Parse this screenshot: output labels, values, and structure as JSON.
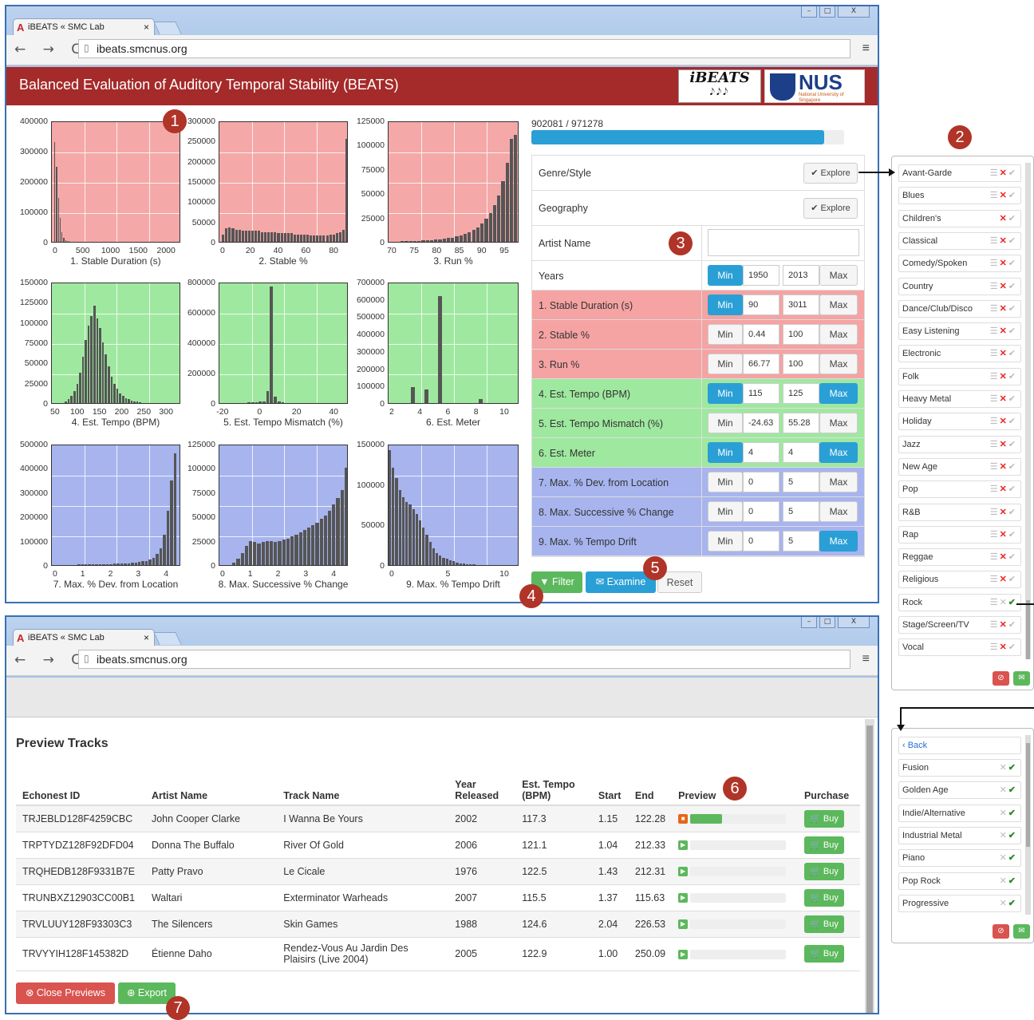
{
  "browser": {
    "tab_title": "iBEATS « SMC Lab",
    "tab_close": "×",
    "url": "ibeats.smcnus.org",
    "nav": "← → C",
    "menu": "≡",
    "win_controls": [
      "–",
      "□",
      "X"
    ]
  },
  "header": {
    "title": "Balanced Evaluation of Auditory Temporal Stability (BEATS)",
    "logo1_top": "iBEATS",
    "logo1_bottom": "𝅘𝅥𝅮𝅘𝅥𝅮𝅘𝅥𝅮",
    "logo2_name": "NUS",
    "logo2_sub": "National University of Singapore"
  },
  "markers": [
    "1",
    "2",
    "3",
    "4",
    "5",
    "6",
    "7"
  ],
  "charts": [
    {
      "caption": "1. Stable Duration (s)",
      "color": "#f5a8a8",
      "yticks": [
        "400000",
        "300000",
        "200000",
        "100000",
        "0"
      ],
      "xticks": [
        "0",
        "500",
        "1000",
        "1500",
        "2000"
      ],
      "bars": [
        0.82,
        0.62,
        0.36,
        0.2,
        0.08,
        0.03,
        0.015,
        0.008,
        0.005,
        0.003,
        0.002,
        0.002,
        0.001,
        0.001,
        0.001,
        0.001,
        0.001,
        0.001,
        0,
        0,
        0,
        0,
        0,
        0,
        0,
        0,
        0,
        0,
        0,
        0,
        0,
        0,
        0,
        0,
        0,
        0
      ],
      "bar_start": 0.02,
      "bar_end": 0.52
    },
    {
      "caption": "2. Stable %",
      "color": "#f5a8a8",
      "yticks": [
        "300000",
        "250000",
        "200000",
        "150000",
        "100000",
        "50000",
        "0"
      ],
      "xticks": [
        "0",
        "20",
        "40",
        "60",
        "80"
      ],
      "bars": [
        0.06,
        0.11,
        0.12,
        0.11,
        0.1,
        0.1,
        0.09,
        0.09,
        0.09,
        0.09,
        0.09,
        0.09,
        0.08,
        0.08,
        0.08,
        0.08,
        0.08,
        0.07,
        0.07,
        0.07,
        0.07,
        0.07,
        0.06,
        0.06,
        0.06,
        0.06,
        0.06,
        0.05,
        0.05,
        0.05,
        0.05,
        0.05,
        0.05,
        0.06,
        0.06,
        0.07,
        0.08,
        0.1,
        0.85
      ],
      "bar_start": 0.02,
      "bar_end": 1.0
    },
    {
      "caption": "3. Run %",
      "color": "#f5a8a8",
      "yticks": [
        "125000",
        "100000",
        "75000",
        "50000",
        "25000",
        "0"
      ],
      "xticks": [
        "70",
        "75",
        "80",
        "85",
        "90",
        "95"
      ],
      "bars": [
        0.003,
        0.004,
        0.005,
        0.006,
        0.007,
        0.008,
        0.01,
        0.012,
        0.014,
        0.017,
        0.02,
        0.024,
        0.03,
        0.036,
        0.044,
        0.054,
        0.066,
        0.08,
        0.1,
        0.12,
        0.15,
        0.19,
        0.24,
        0.3,
        0.38,
        0.5,
        0.65,
        0.85,
        0.88
      ],
      "bar_start": 0.06,
      "bar_end": 0.99
    },
    {
      "caption": "4. Est. Tempo (BPM)",
      "color": "#9fe89f",
      "yticks": [
        "150000",
        "125000",
        "100000",
        "75000",
        "50000",
        "25000",
        "0"
      ],
      "xticks": [
        "50",
        "100",
        "150",
        "200",
        "250",
        "300"
      ],
      "bars": [
        0.01,
        0.03,
        0.06,
        0.1,
        0.16,
        0.25,
        0.38,
        0.52,
        0.64,
        0.72,
        0.8,
        0.7,
        0.62,
        0.5,
        0.4,
        0.3,
        0.22,
        0.16,
        0.12,
        0.08,
        0.06,
        0.04,
        0.03,
        0.02,
        0.01,
        0.01,
        0.005,
        0.003
      ],
      "bar_start": 0.1,
      "bar_end": 0.72
    },
    {
      "caption": "5. Est. Tempo Mismatch (%)",
      "color": "#9fe89f",
      "yticks": [
        "800000",
        "600000",
        "400000",
        "200000",
        "0"
      ],
      "xticks": [
        "-20",
        "0",
        "20",
        "40"
      ],
      "bars": [
        0.002,
        0.002,
        0.003,
        0.003,
        0.004,
        0.006,
        0.008,
        0.012,
        0.015,
        0.1,
        0.96,
        0.05,
        0.01,
        0.005,
        0.003,
        0.002,
        0.001,
        0.001,
        0.001,
        0.001,
        0.001,
        0.001,
        0.001,
        0.001
      ],
      "bar_start": 0.1,
      "bar_end": 0.8
    },
    {
      "caption": "6. Est. Meter",
      "color": "#9fe89f",
      "yticks": [
        "700000",
        "600000",
        "500000",
        "400000",
        "300000",
        "200000",
        "100000",
        "0"
      ],
      "xticks": [
        "2",
        "4",
        "6",
        "8",
        "10"
      ],
      "bars": [
        0,
        0,
        0,
        0,
        0,
        0.13,
        0,
        0,
        0.11,
        0,
        0,
        0.88,
        0,
        0,
        0,
        0,
        0,
        0,
        0,
        0,
        0.03,
        0,
        0,
        0,
        0,
        0,
        0,
        0,
        0
      ],
      "bar_start": 0.0,
      "bar_end": 1.0
    },
    {
      "caption": "7. Max. % Dev. from Location",
      "color": "#a7b4ee",
      "yticks": [
        "500000",
        "400000",
        "300000",
        "200000",
        "100000",
        "0"
      ],
      "xticks": [
        "0",
        "1",
        "2",
        "3",
        "4"
      ],
      "bars": [
        0.002,
        0.002,
        0.003,
        0.003,
        0.003,
        0.004,
        0.004,
        0.005,
        0.005,
        0.006,
        0.006,
        0.007,
        0.007,
        0.008,
        0.009,
        0.01,
        0.011,
        0.012,
        0.014,
        0.016,
        0.018,
        0.021,
        0.025,
        0.03,
        0.036,
        0.045,
        0.06,
        0.09,
        0.14,
        0.25,
        0.45,
        0.7,
        0.92
      ],
      "bar_start": 0.06,
      "bar_end": 0.97
    },
    {
      "caption": "8. Max. Successive % Change",
      "color": "#a7b4ee",
      "yticks": [
        "125000",
        "100000",
        "75000",
        "50000",
        "25000",
        "0"
      ],
      "xticks": [
        "0",
        "1",
        "2",
        "3",
        "4"
      ],
      "bars": [
        0.02,
        0.05,
        0.1,
        0.16,
        0.2,
        0.19,
        0.18,
        0.19,
        0.2,
        0.2,
        0.19,
        0.2,
        0.21,
        0.22,
        0.24,
        0.25,
        0.27,
        0.29,
        0.31,
        0.33,
        0.35,
        0.38,
        0.41,
        0.45,
        0.5,
        0.55,
        0.62,
        0.8
      ],
      "bar_start": 0.1,
      "bar_end": 1.0
    },
    {
      "caption": "9. Max. % Tempo Drift",
      "color": "#a7b4ee",
      "yticks": [
        "150000",
        "100000",
        "50000",
        "0"
      ],
      "xticks": [
        "0",
        "5",
        "10"
      ],
      "bars": [
        0.95,
        0.8,
        0.72,
        0.62,
        0.56,
        0.52,
        0.5,
        0.46,
        0.42,
        0.37,
        0.31,
        0.25,
        0.19,
        0.14,
        0.1,
        0.08,
        0.06,
        0.05,
        0.04,
        0.03,
        0.02,
        0.015,
        0.01,
        0.008,
        0.005,
        0.004,
        0.003,
        0.002
      ],
      "bar_start": 0.0,
      "bar_end": 0.72
    }
  ],
  "filters": {
    "count": "902081 / 971278",
    "progress": 0.935,
    "rows": [
      {
        "label": "Genre/Style",
        "type": "explore",
        "button": "✔ Explore",
        "color": "plain"
      },
      {
        "label": "Geography",
        "type": "explore",
        "button": "✔ Explore",
        "color": "plain"
      },
      {
        "label": "Artist Name",
        "type": "text",
        "value": "",
        "color": "plain"
      },
      {
        "label": "Years",
        "type": "range",
        "min": "1950",
        "max": "2013",
        "min_on": true,
        "max_on": false,
        "color": "plain"
      },
      {
        "label": "1. Stable Duration (s)",
        "type": "range",
        "min": "90",
        "max": "3011",
        "min_on": true,
        "max_on": false,
        "color": "red"
      },
      {
        "label": "2. Stable %",
        "type": "range",
        "min": "0.44",
        "max": "100",
        "min_on": false,
        "max_on": false,
        "color": "red"
      },
      {
        "label": "3. Run %",
        "type": "range",
        "min": "66.77",
        "max": "100",
        "min_on": false,
        "max_on": false,
        "color": "red"
      },
      {
        "label": "4. Est. Tempo (BPM)",
        "type": "range",
        "min": "115",
        "max": "125",
        "min_on": true,
        "max_on": true,
        "color": "green"
      },
      {
        "label": "5. Est. Tempo Mismatch (%)",
        "type": "range",
        "min": "-24.63",
        "max": "55.28",
        "min_on": false,
        "max_on": false,
        "color": "green"
      },
      {
        "label": "6. Est. Meter",
        "type": "range",
        "min": "4",
        "max": "4",
        "min_on": true,
        "max_on": true,
        "color": "green"
      },
      {
        "label": "7. Max. % Dev. from Location",
        "type": "range",
        "min": "0",
        "max": "5",
        "min_on": false,
        "max_on": false,
        "color": "blue"
      },
      {
        "label": "8. Max. Successive % Change",
        "type": "range",
        "min": "0",
        "max": "5",
        "min_on": false,
        "max_on": false,
        "color": "blue"
      },
      {
        "label": "9. Max. % Tempo Drift",
        "type": "range",
        "min": "0",
        "max": "5",
        "min_on": false,
        "max_on": true,
        "color": "blue"
      }
    ],
    "min_label": "Min",
    "max_label": "Max",
    "actions": {
      "filter": "▼ Filter",
      "examine": "✉ Examine",
      "reset": "Reset"
    }
  },
  "genres": {
    "items": [
      {
        "name": "Avant-Garde",
        "state": "x"
      },
      {
        "name": "Blues",
        "state": "x"
      },
      {
        "name": "Children's",
        "state": "x2"
      },
      {
        "name": "Classical",
        "state": "x"
      },
      {
        "name": "Comedy/Spoken",
        "state": "x"
      },
      {
        "name": "Country",
        "state": "x"
      },
      {
        "name": "Dance/Club/Disco",
        "state": "x"
      },
      {
        "name": "Easy Listening",
        "state": "x"
      },
      {
        "name": "Electronic",
        "state": "x"
      },
      {
        "name": "Folk",
        "state": "x"
      },
      {
        "name": "Heavy Metal",
        "state": "x"
      },
      {
        "name": "Holiday",
        "state": "x"
      },
      {
        "name": "Jazz",
        "state": "x"
      },
      {
        "name": "New Age",
        "state": "x"
      },
      {
        "name": "Pop",
        "state": "x"
      },
      {
        "name": "R&B",
        "state": "x"
      },
      {
        "name": "Rap",
        "state": "x"
      },
      {
        "name": "Reggae",
        "state": "x"
      },
      {
        "name": "Religious",
        "state": "x"
      },
      {
        "name": "Rock",
        "state": "c"
      },
      {
        "name": "Stage/Screen/TV",
        "state": "x"
      },
      {
        "name": "Vocal",
        "state": "x"
      }
    ],
    "list_icon": "☰",
    "cross": "✕",
    "check": "✔",
    "cancel": "⊘",
    "ok": "✉"
  },
  "styles": {
    "back": "‹ Back",
    "items": [
      "Fusion",
      "Golden Age",
      "Indie/Alternative",
      "Industrial Metal",
      "Piano",
      "Pop Rock",
      "Progressive"
    ]
  },
  "preview": {
    "title": "Preview Tracks",
    "columns": [
      "Echonest ID",
      "Artist Name",
      "Track Name",
      "Year Released",
      "Est. Tempo (BPM)",
      "Start",
      "End",
      "Preview",
      "Purchase"
    ],
    "rows": [
      {
        "id": "TRJEBLD128F4259CBC",
        "artist": "John Cooper Clarke",
        "track": "I Wanna Be Yours",
        "year": "2002",
        "tempo": "117.3",
        "start": "1.15",
        "end": "122.28",
        "progress": 0.33,
        "playing": true
      },
      {
        "id": "TRPTYDZ128F92DFD04",
        "artist": "Donna The Buffalo",
        "track": "River Of Gold",
        "year": "2006",
        "tempo": "121.1",
        "start": "1.04",
        "end": "212.33",
        "progress": 0,
        "playing": false
      },
      {
        "id": "TRQHEDB128F9331B7E",
        "artist": "Patty Pravo",
        "track": "Le Cicale",
        "year": "1976",
        "tempo": "122.5",
        "start": "1.43",
        "end": "212.31",
        "progress": 0,
        "playing": false
      },
      {
        "id": "TRUNBXZ12903CC00B1",
        "artist": "Waltari",
        "track": "Exterminator Warheads",
        "year": "2007",
        "tempo": "115.5",
        "start": "1.37",
        "end": "115.63",
        "progress": 0,
        "playing": false
      },
      {
        "id": "TRVLUUY128F93303C3",
        "artist": "The Silencers",
        "track": "Skin Games",
        "year": "1988",
        "tempo": "124.6",
        "start": "2.04",
        "end": "226.53",
        "progress": 0,
        "playing": false
      },
      {
        "id": "TRVYYIH128F145382D",
        "artist": "Étienne Daho",
        "track": "Rendez-Vous Au Jardin Des Plaisirs (Live 2004)",
        "year": "2005",
        "tempo": "122.9",
        "start": "1.00",
        "end": "250.09",
        "progress": 0,
        "playing": false
      }
    ],
    "buy": "🛒 Buy",
    "close": "⊗ Close Previews",
    "export": "⊕ Export"
  }
}
